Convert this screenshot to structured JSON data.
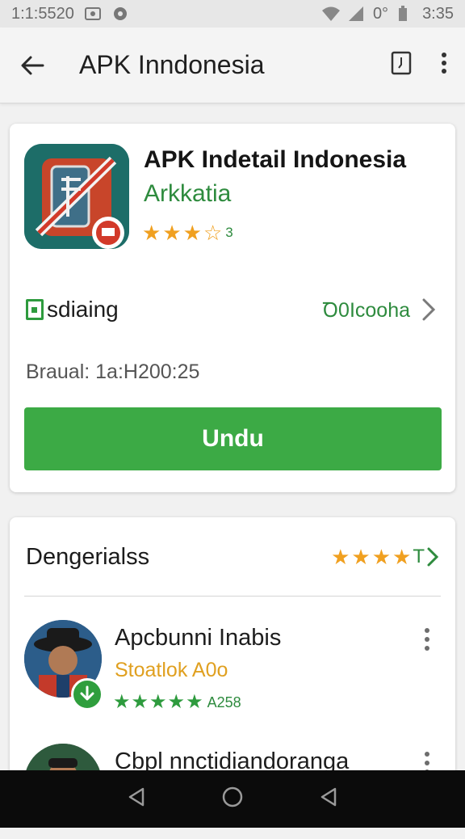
{
  "status_bar": {
    "left_text": "1:1:5520",
    "signal_text": "0°",
    "time": "3:35"
  },
  "app_bar": {
    "title": "APK Inndonesia",
    "icons": [
      "back-arrow-icon",
      "bookmark-icon",
      "more-vert-icon"
    ]
  },
  "app_card": {
    "name": "APK Indetail Indonesia",
    "developer": "Arkkatia",
    "rating_label": "3",
    "category_label": "sdiaing",
    "category_value": "Ꝺ0Icooha",
    "version": "Braual: 1a:H200:25",
    "download_label": "Undu"
  },
  "reviews_section": {
    "title": "Dengerialss",
    "header_trailing": "T",
    "reviews": [
      {
        "name": "Apcbunni Inabis",
        "tag": "Stoatlok A0o",
        "count": "A258"
      },
      {
        "name": "Cbpl nnctidiandoranga",
        "tag": "",
        "count": ""
      }
    ]
  },
  "colors": {
    "accent_green": "#3caa45",
    "text_green": "#2e8b3e",
    "star_orange": "#f0a020",
    "nav_bar": "#0b0b0b"
  }
}
